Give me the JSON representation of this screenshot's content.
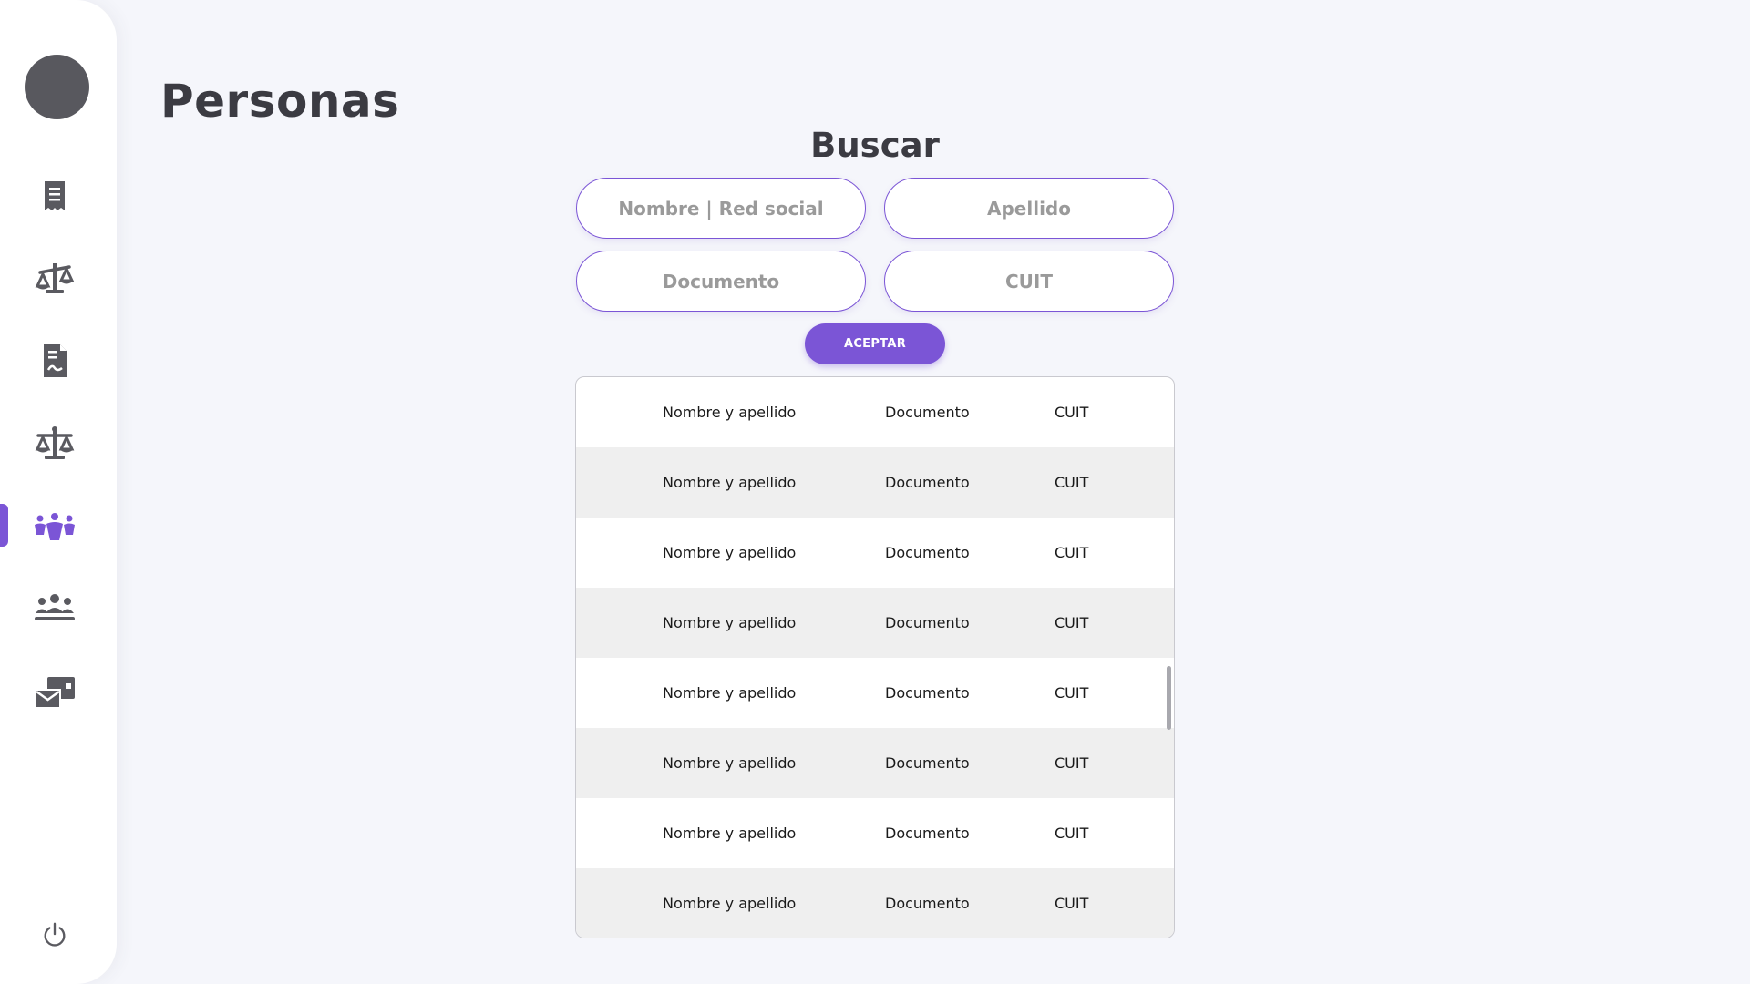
{
  "page": {
    "title": "Personas"
  },
  "sidebar": {
    "items": [
      {
        "name": "receipt-icon",
        "active": false
      },
      {
        "name": "scale-icon",
        "active": false
      },
      {
        "name": "document-icon",
        "active": false
      },
      {
        "name": "balance-icon",
        "active": false
      },
      {
        "name": "people-icon",
        "active": true
      },
      {
        "name": "group-icon",
        "active": false
      },
      {
        "name": "mail-icon",
        "active": false
      }
    ],
    "power_icon": "power-icon",
    "accent_color": "#7b55d6",
    "icon_color": "#5a5a60"
  },
  "search": {
    "title": "Buscar",
    "name_placeholder": "Nombre | Red social",
    "lastname_placeholder": "Apellido",
    "document_placeholder": "Documento",
    "cuit_placeholder": "CUIT",
    "accept_label": "ACEPTAR"
  },
  "table": {
    "rows": [
      {
        "name": "Nombre y apellido",
        "document": "Documento",
        "cuit": "CUIT"
      },
      {
        "name": "Nombre y apellido",
        "document": "Documento",
        "cuit": "CUIT"
      },
      {
        "name": "Nombre y apellido",
        "document": "Documento",
        "cuit": "CUIT"
      },
      {
        "name": "Nombre y apellido",
        "document": "Documento",
        "cuit": "CUIT"
      },
      {
        "name": "Nombre y apellido",
        "document": "Documento",
        "cuit": "CUIT"
      },
      {
        "name": "Nombre y apellido",
        "document": "Documento",
        "cuit": "CUIT"
      },
      {
        "name": "Nombre y apellido",
        "document": "Documento",
        "cuit": "CUIT"
      },
      {
        "name": "Nombre y apellido",
        "document": "Documento",
        "cuit": "CUIT"
      }
    ]
  }
}
